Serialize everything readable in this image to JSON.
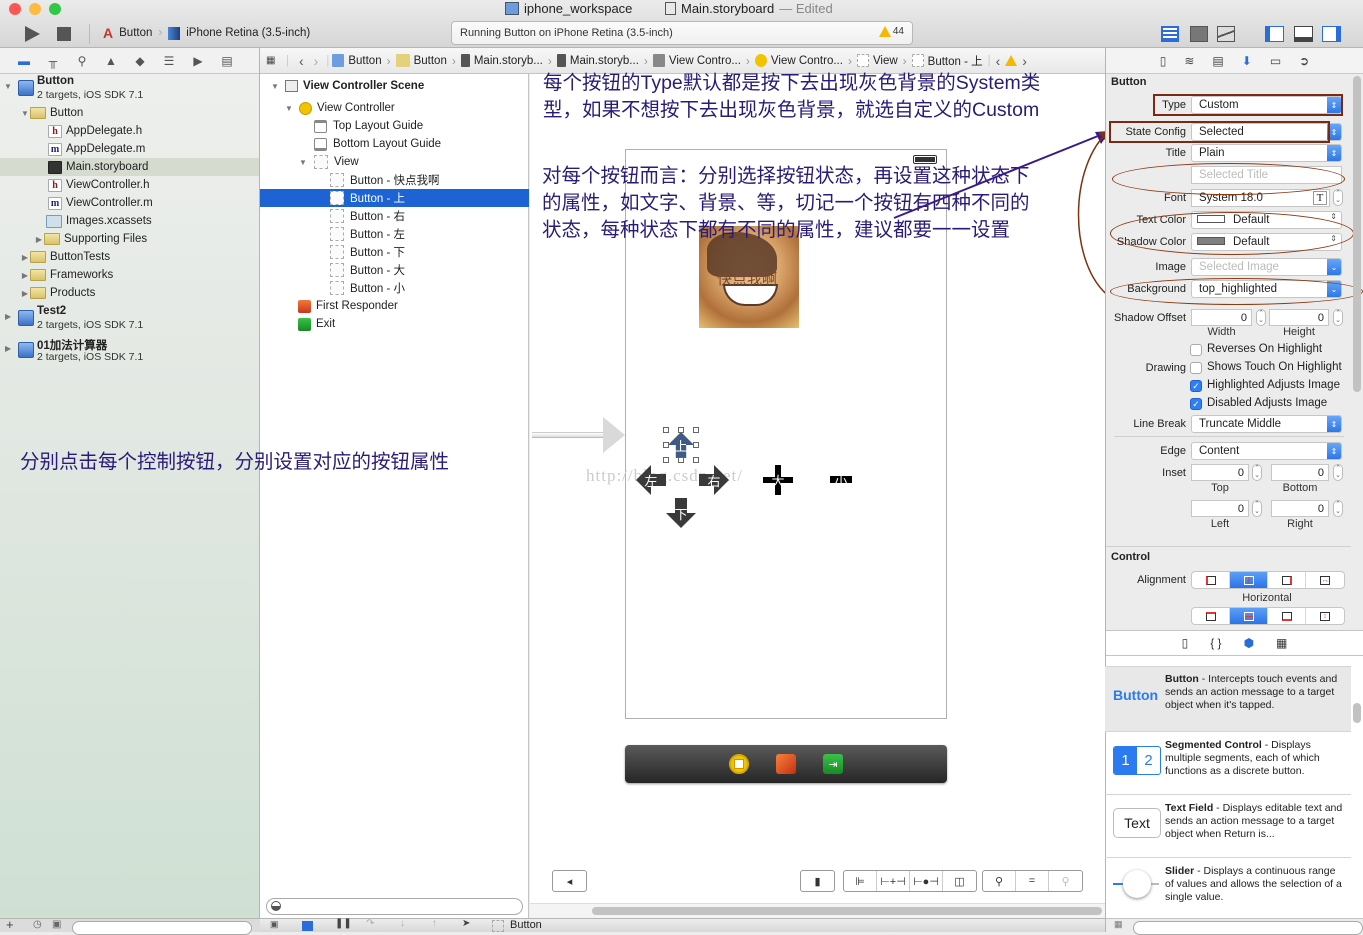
{
  "window": {
    "workspace_title": "iphone_workspace",
    "document_title": "Main.storyboard",
    "edited_label": "— Edited"
  },
  "toolbar": {
    "scheme": "Button",
    "destination": "iPhone Retina (3.5-inch)",
    "activity_text": "Running Button on iPhone Retina (3.5-inch)",
    "warning_count": "44",
    "colors": {
      "close": "#fc5753",
      "minimize": "#fdbc40",
      "zoom": "#33c748",
      "accent": "#2a6dd8"
    }
  },
  "navigator": {
    "tabs": [
      "folder-icon",
      "hierarchy-icon",
      "search-icon",
      "warning-icon",
      "breakpoint-icon",
      "list-icon",
      "tag-icon",
      "log-icon"
    ],
    "projects": [
      {
        "name": "Button",
        "subtitle": "2 targets, iOS SDK 7.1"
      },
      {
        "name": "Test2",
        "subtitle": "2 targets, iOS SDK 7.1"
      },
      {
        "name": "01加法计算器",
        "subtitle": "2 targets, iOS SDK 7.1"
      }
    ],
    "files": [
      {
        "label": "Button",
        "kind": "folder"
      },
      {
        "label": "AppDelegate.h",
        "kind": "h"
      },
      {
        "label": "AppDelegate.m",
        "kind": "m"
      },
      {
        "label": "Main.storyboard",
        "kind": "storyboard",
        "selected": true
      },
      {
        "label": "ViewController.h",
        "kind": "h"
      },
      {
        "label": "ViewController.m",
        "kind": "m"
      },
      {
        "label": "Images.xcassets",
        "kind": "xcassets"
      },
      {
        "label": "Supporting Files",
        "kind": "folder"
      },
      {
        "label": "ButtonTests",
        "kind": "folder"
      },
      {
        "label": "Frameworks",
        "kind": "folder"
      },
      {
        "label": "Products",
        "kind": "folder"
      }
    ],
    "file_glyphs": {
      "h": "h",
      "m": "m"
    }
  },
  "jumpbar": {
    "items": [
      "Button",
      "Button",
      "Main.storyb...",
      "Main.storyb...",
      "View Contro...",
      "View Contro...",
      "View",
      "Button - 上"
    ]
  },
  "outline": {
    "scene": "View Controller Scene",
    "controller": "View Controller",
    "top_guide": "Top Layout Guide",
    "bottom_guide": "Bottom Layout Guide",
    "view": "View",
    "buttons": [
      "Button - 快点我啊",
      "Button - 上",
      "Button - 右",
      "Button - 左",
      "Button - 下",
      "Button - 大",
      "Button - 小"
    ],
    "selected_index": 1,
    "first_responder": "First Responder",
    "exit": "Exit"
  },
  "canvas": {
    "note_type": "每个按钮的Type默认都是按下去出现灰色背景的System类型，如果不想按下去出现灰色背景，就选自定义的Custom",
    "note_state": "对每个按钮而言：分别选择按钮状态，再设置这种状态下的属性，如文字、背景、等，切记一个按钮有四种不同的状态，每种状态下都有不同的属性，建议都要一一设置",
    "note_left": "分别点击每个控制按钮，分别设置对应的按钮属性",
    "image_button_title": "快点我啊",
    "dpad": {
      "up": "上",
      "left": "左",
      "right": "右",
      "down": "下",
      "big": "大",
      "small": "小"
    },
    "watermark": "http://blog.csdn.net/"
  },
  "inspector": {
    "tabs": [
      "file-icon",
      "quick-help-icon",
      "identity-icon",
      "attributes-icon",
      "size-icon",
      "connections-icon"
    ],
    "section_button": "Button",
    "type_label": "Type",
    "type_value": "Custom",
    "state_label": "State Config",
    "state_value": "Selected",
    "title_label": "Title",
    "title_value": "Plain",
    "title_placeholder": "Selected Title",
    "font_label": "Font",
    "font_value": "System 18.0",
    "text_color_label": "Text Color",
    "text_color_value": "Default",
    "shadow_color_label": "Shadow Color",
    "shadow_color_value": "Default",
    "image_label": "Image",
    "image_placeholder": "Selected Image",
    "background_label": "Background",
    "background_value": "top_highlighted",
    "shadow_offset_label": "Shadow Offset",
    "shadow_width": "0",
    "shadow_height": "0",
    "width_label": "Width",
    "height_label": "Height",
    "drawing_label": "Drawing",
    "checks": [
      {
        "label": "Reverses On Highlight",
        "checked": false
      },
      {
        "label": "Shows Touch On Highlight",
        "checked": false
      },
      {
        "label": "Highlighted Adjusts Image",
        "checked": true
      },
      {
        "label": "Disabled Adjusts Image",
        "checked": true
      }
    ],
    "line_break_label": "Line Break",
    "line_break_value": "Truncate Middle",
    "edge_label": "Edge",
    "edge_value": "Content",
    "inset_label": "Inset",
    "inset_top": "0",
    "inset_bottom": "0",
    "inset_left": "0",
    "inset_right": "0",
    "top_label": "Top",
    "bottom_label": "Bottom",
    "left_label": "Left",
    "right_label": "Right",
    "section_control": "Control",
    "alignment_label": "Alignment",
    "horizontal_label": "Horizontal",
    "horizontal_selected": 1,
    "vertical_selected": 1
  },
  "library": {
    "tabs": [
      "file-template-icon",
      "code-snippet-icon",
      "object-icon",
      "media-icon"
    ],
    "items": [
      {
        "icon_text": "Button",
        "name": "Button",
        "desc": " - Intercepts touch events and sends an action message to a target object when it's tapped."
      },
      {
        "icon_text": "1 2",
        "name": "Segmented Control",
        "desc": " - Displays multiple segments, each of which functions as a discrete button."
      },
      {
        "icon_text": "Text",
        "name": "Text Field",
        "desc": " - Displays editable text and sends an action message to a target object when Return is..."
      },
      {
        "icon_text": "",
        "name": "Slider",
        "desc": " - Displays a continuous range of values and allows the selection of a single value."
      }
    ]
  },
  "debugbar": {
    "context": "Button"
  }
}
